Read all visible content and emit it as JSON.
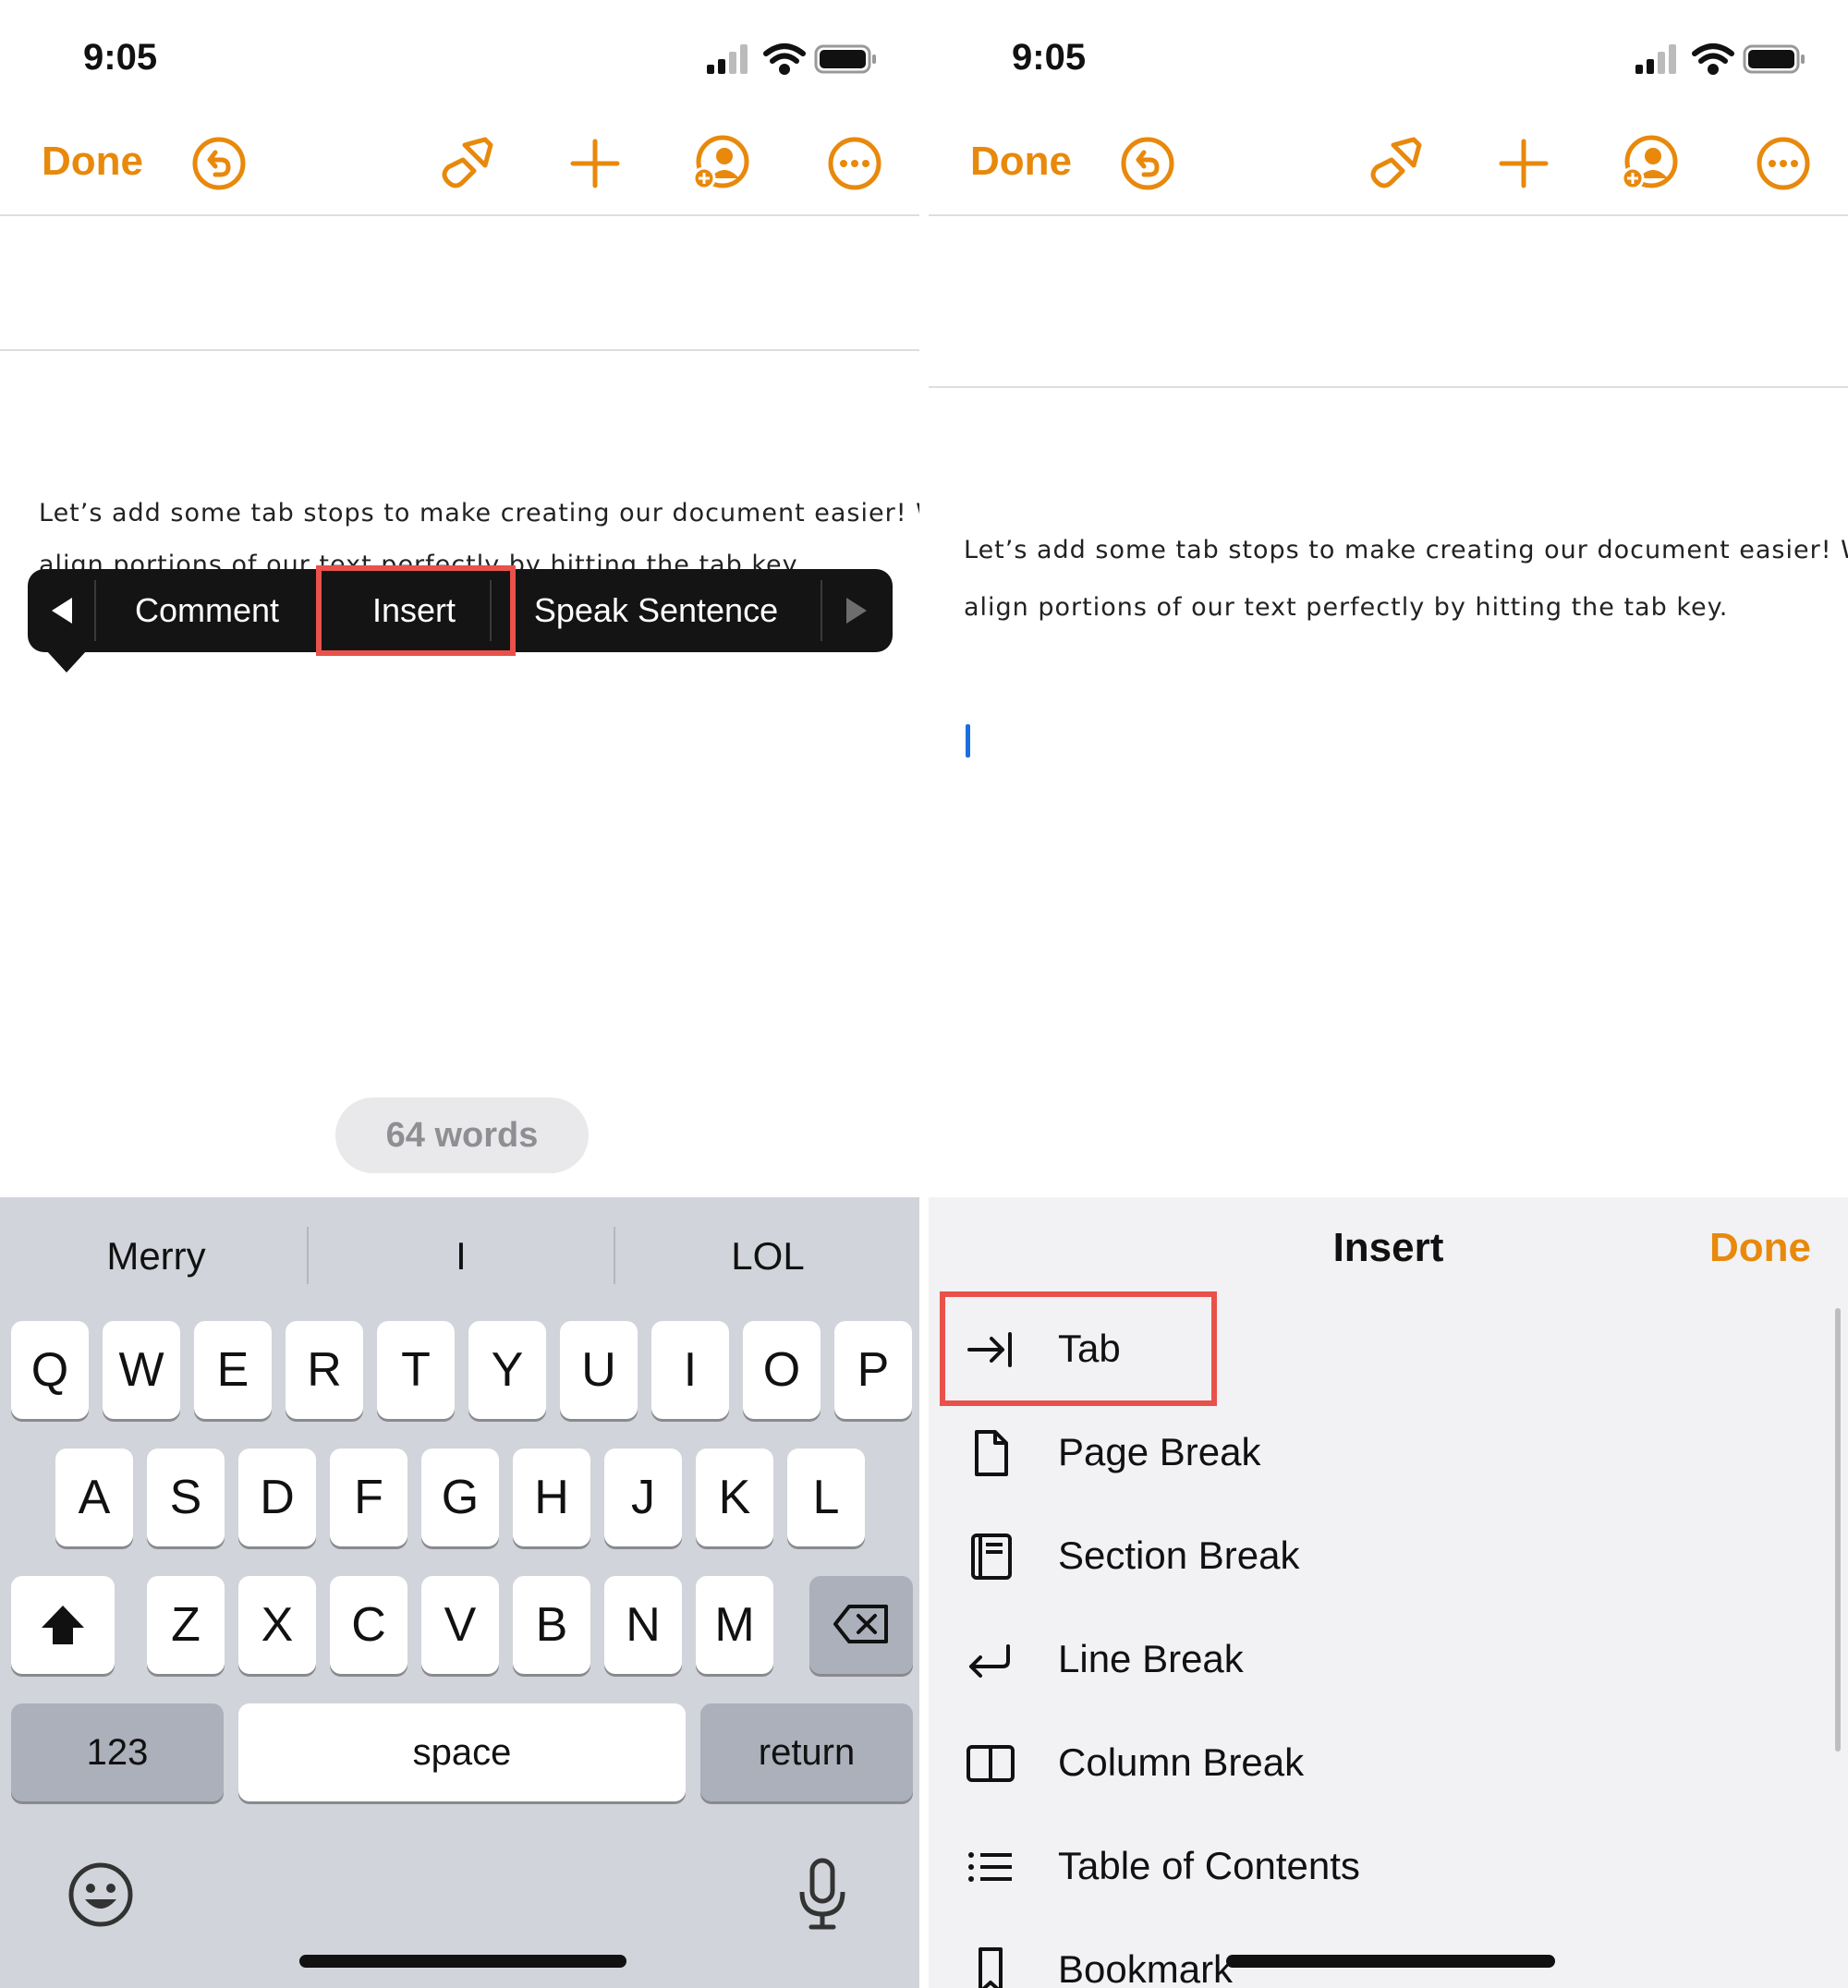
{
  "colors": {
    "accent": "#E8890C",
    "highlight": "#E8524A",
    "caret": "#1A6FE0"
  },
  "left": {
    "status": {
      "time": "9:05"
    },
    "toolbar": {
      "done_label": "Done",
      "icons": [
        "undo-icon",
        "format-brush-icon",
        "add-icon",
        "collaborate-icon",
        "more-icon"
      ]
    },
    "document": {
      "line1": "Let’s add some tab stops to make creating our document easier! We c",
      "line2": "align portions of our text perfectly by hitting the tab key."
    },
    "context_menu": {
      "prev_icon": "left-arrow-icon",
      "items": [
        "Comment",
        "Insert",
        "Speak Sentence"
      ],
      "next_icon": "right-arrow-icon",
      "highlighted": "Insert"
    },
    "word_count": "64 words",
    "keyboard": {
      "suggestions": [
        "Merry",
        "I",
        "LOL"
      ],
      "row1": [
        "Q",
        "W",
        "E",
        "R",
        "T",
        "Y",
        "U",
        "I",
        "O",
        "P"
      ],
      "row2": [
        "A",
        "S",
        "D",
        "F",
        "G",
        "H",
        "J",
        "K",
        "L"
      ],
      "row3": [
        "Z",
        "X",
        "C",
        "V",
        "B",
        "N",
        "M"
      ],
      "numbers_key": "123",
      "space_key": "space",
      "return_key": "return"
    }
  },
  "right": {
    "status": {
      "time": "9:05"
    },
    "toolbar": {
      "done_label": "Done"
    },
    "document": {
      "line1": "Let’s add some tab stops to make creating our document easier! We c",
      "line2": "align portions of our text perfectly by hitting the tab key."
    },
    "insert_sheet": {
      "title": "Insert",
      "done_label": "Done",
      "items": [
        {
          "label": "Tab",
          "icon": "tab-icon"
        },
        {
          "label": "Page Break",
          "icon": "page-icon"
        },
        {
          "label": "Section Break",
          "icon": "section-icon"
        },
        {
          "label": "Line Break",
          "icon": "line-break-icon"
        },
        {
          "label": "Column Break",
          "icon": "column-icon"
        },
        {
          "label": "Table of Contents",
          "icon": "list-icon"
        },
        {
          "label": "Bookmark",
          "icon": "bookmark-icon"
        }
      ],
      "highlighted": "Tab"
    }
  }
}
